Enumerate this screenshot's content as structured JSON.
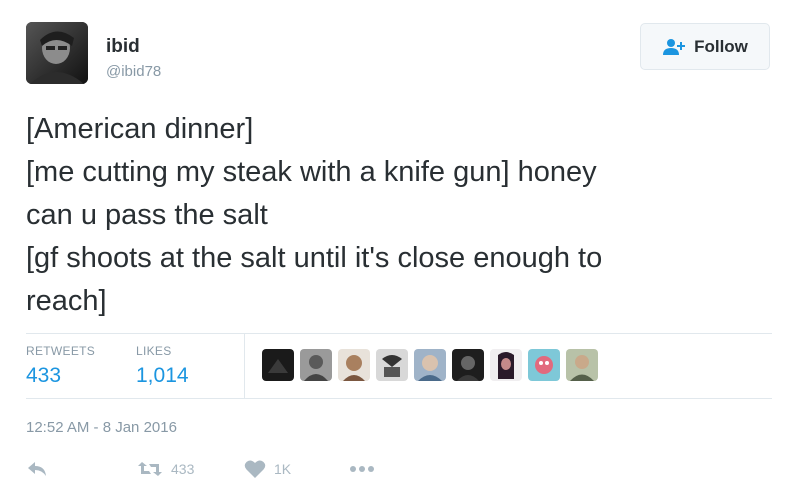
{
  "author": {
    "name": "ibid",
    "handle": "@ibid78"
  },
  "follow_button": {
    "label": "Follow",
    "icon": "add-user-icon"
  },
  "tweet": {
    "lines": [
      "[American dinner]",
      "[me cutting my steak with a knife gun] honey",
      "can u pass the salt",
      "[gf shoots at the salt until it's close enough to",
      "reach]"
    ]
  },
  "stats": {
    "retweets_label": "RETWEETS",
    "retweets_value": "433",
    "likes_label": "LIKES",
    "likes_value": "1,014"
  },
  "liker_avatars": [
    {
      "icon": "liker-avatar-1",
      "color": "#1a1a1a"
    },
    {
      "icon": "liker-avatar-2",
      "color": "#6b6b6b"
    },
    {
      "icon": "liker-avatar-3",
      "color": "#8a6a55"
    },
    {
      "icon": "liker-avatar-4",
      "color": "#3d3d3d"
    },
    {
      "icon": "liker-avatar-5",
      "color": "#7b8fa8"
    },
    {
      "icon": "liker-avatar-6",
      "color": "#2b2b2b"
    },
    {
      "icon": "liker-avatar-7",
      "color": "#5a2a4a"
    },
    {
      "icon": "liker-avatar-8",
      "color": "#d9657a"
    },
    {
      "icon": "liker-avatar-9",
      "color": "#5e6b55"
    }
  ],
  "timestamp": "12:52 AM - 8 Jan 2016",
  "actions": {
    "reply_icon": "reply-icon",
    "retweet_icon": "retweet-icon",
    "retweet_count": "433",
    "like_icon": "heart-icon",
    "like_count": "1K",
    "more_icon": "more-dots-icon"
  },
  "colors": {
    "link_blue": "#1b95e0",
    "muted_gray": "#8899a6",
    "icon_gray": "#aab8c2",
    "text_dark": "#292f33"
  }
}
